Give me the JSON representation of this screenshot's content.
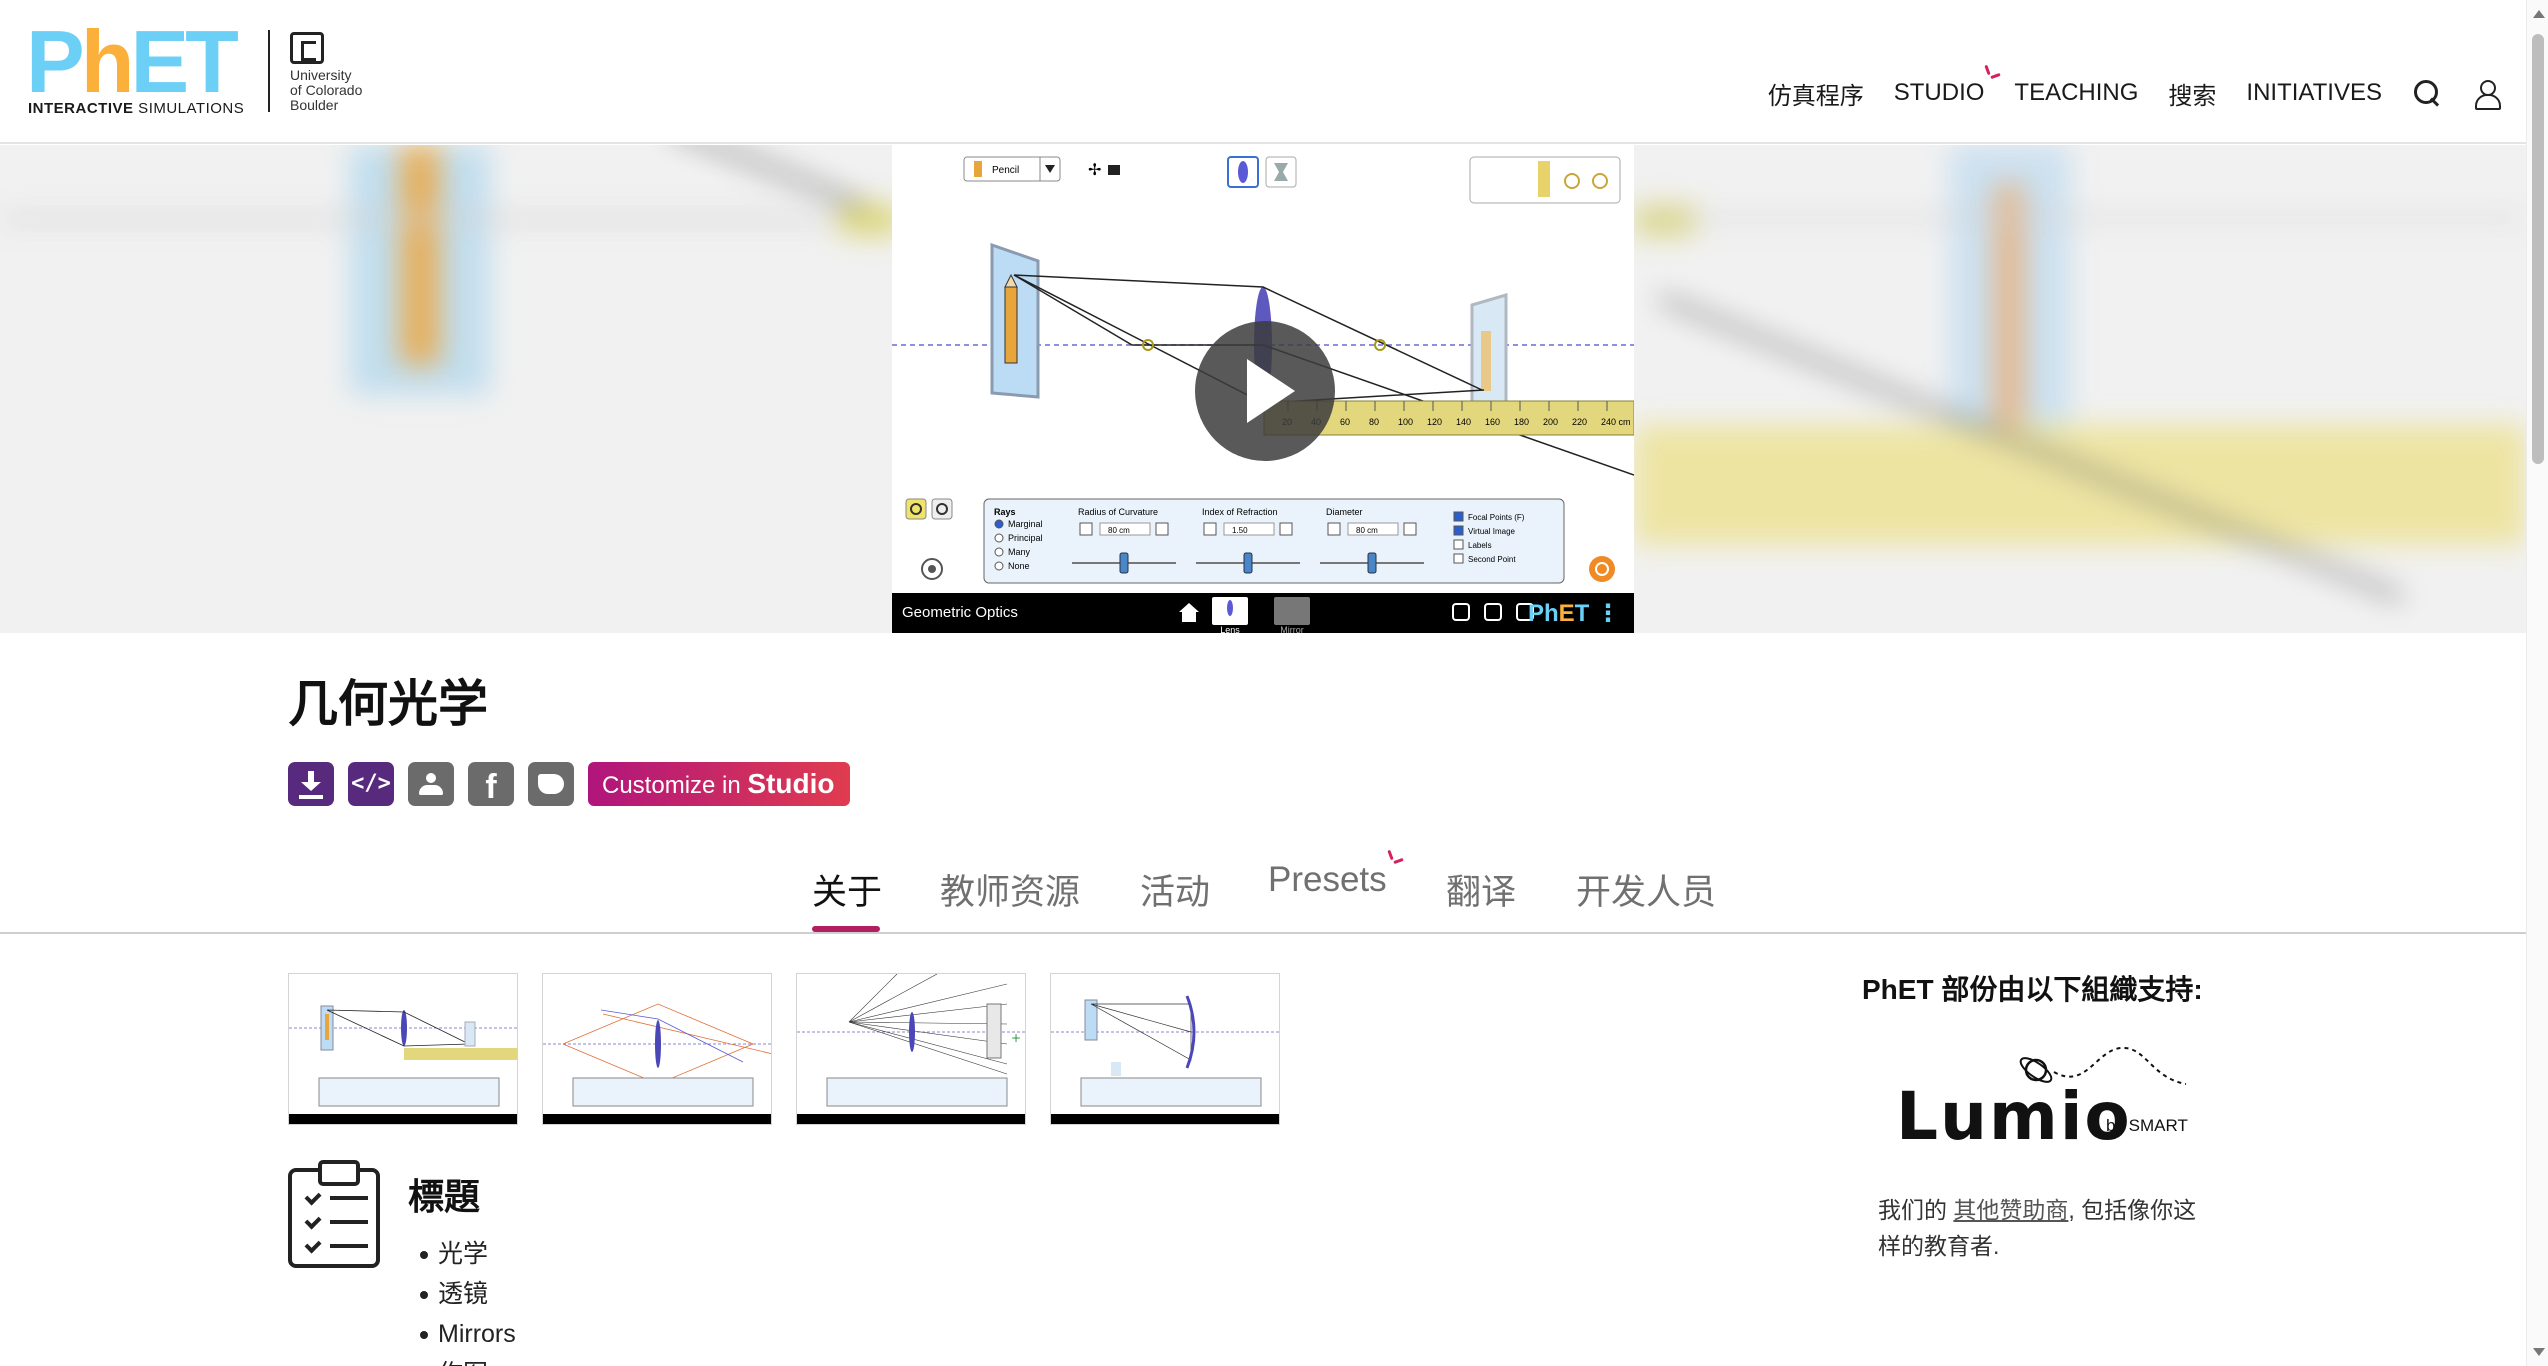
{
  "header": {
    "logo": {
      "wordmark": "PhET",
      "sub_bold": "INTERACTIVE",
      "sub_rest": " SIMULATIONS"
    },
    "cu": {
      "line1": "University",
      "line2": "of Colorado",
      "line3": "Boulder"
    },
    "nav": [
      {
        "label": "仿真程序"
      },
      {
        "label": "STUDIO"
      },
      {
        "label": "TEACHING"
      },
      {
        "label": "搜索"
      },
      {
        "label": "INITIATIVES"
      }
    ],
    "icons": [
      "search-icon",
      "user-icon"
    ]
  },
  "sim_preview": {
    "toolbar_object": "Pencil",
    "panel": {
      "rays_label": "Rays",
      "rays": [
        "Marginal",
        "Principal",
        "Many",
        "None"
      ],
      "selected_ray": "Marginal",
      "controls": [
        {
          "label": "Radius of Curvature",
          "value": "80 cm"
        },
        {
          "label": "Index of Refraction",
          "value": "1.50"
        },
        {
          "label": "Diameter",
          "value": "80 cm"
        }
      ],
      "checkboxes": [
        {
          "label": "Focal Points (F)",
          "checked": true
        },
        {
          "label": "Virtual Image",
          "checked": true
        },
        {
          "label": "Labels",
          "checked": false
        },
        {
          "label": "Second Point",
          "checked": false
        }
      ]
    },
    "ruler_ticks": [
      "20",
      "40",
      "60",
      "80",
      "100",
      "120",
      "140",
      "160",
      "180",
      "200",
      "220",
      "240 cm"
    ],
    "navbar": {
      "title": "Geometric Optics",
      "screens": [
        "Lens",
        "Mirror"
      ],
      "logo": "PhET"
    }
  },
  "page": {
    "title": "几何光学",
    "studio_button": {
      "prefix": "Customize in ",
      "brand": "Studio"
    }
  },
  "tabs": [
    {
      "label": "关于",
      "active": true
    },
    {
      "label": "教师资源",
      "active": false
    },
    {
      "label": "活动",
      "active": false
    },
    {
      "label": "Presets",
      "active": false
    },
    {
      "label": "翻译",
      "active": false
    },
    {
      "label": "开发人员",
      "active": false
    }
  ],
  "topics": {
    "title": "標題",
    "items": [
      "光学",
      "透镜",
      "Mirrors",
      "作图"
    ]
  },
  "sponsor": {
    "title": "PhET 部份由以下組織支持:",
    "logo_word": "Lumio",
    "logo_by": "by SMART",
    "text_before": "我们的 ",
    "link": "其他赞助商",
    "text_after": ", 包括像你这样的教育者."
  },
  "colors": {
    "phet_blue": "#6ccff6",
    "phet_orange": "#fbb03b",
    "brand_purple": "#572a7e",
    "accent_magenta": "#b21f60",
    "studio_gradient_start": "#b0157c",
    "studio_gradient_end": "#e03c4f"
  }
}
